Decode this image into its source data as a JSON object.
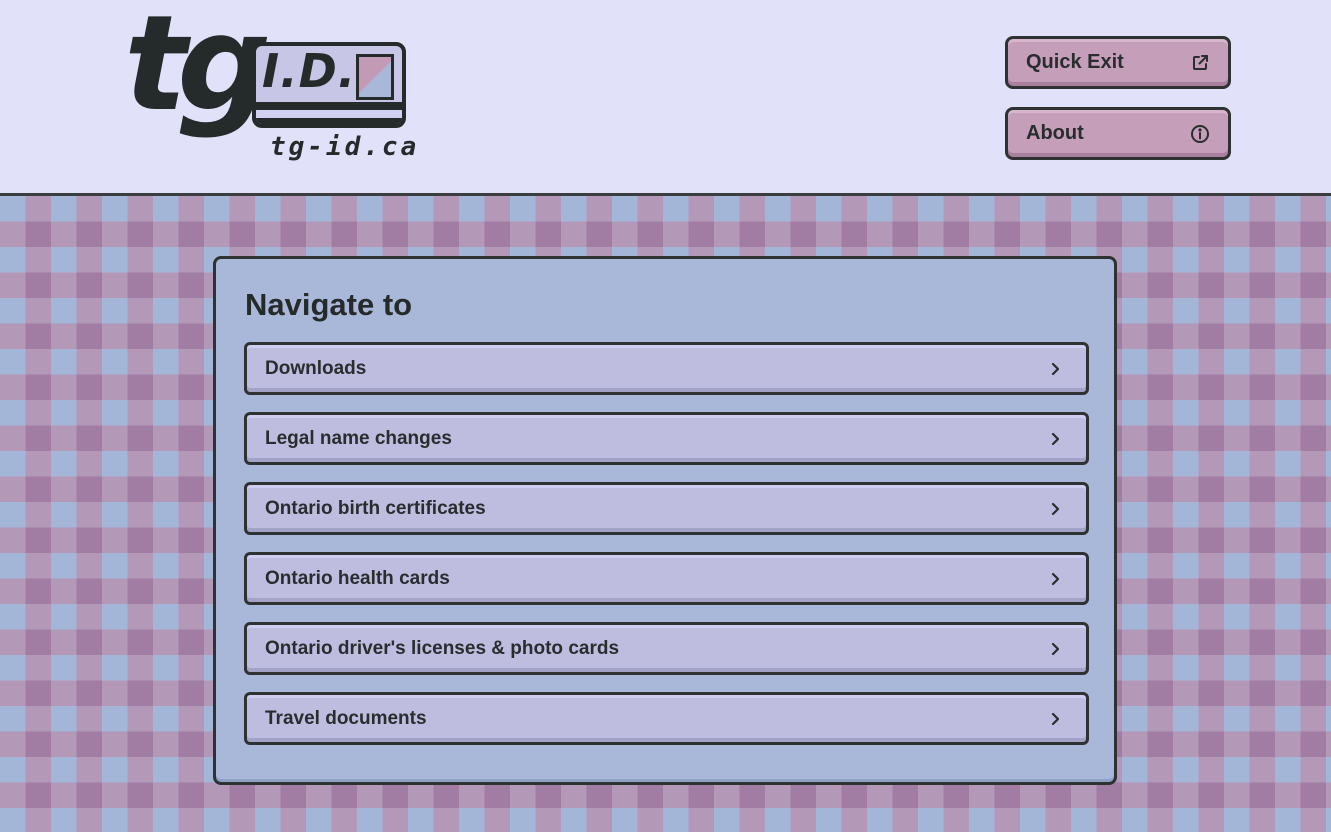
{
  "header": {
    "logo": {
      "wordmark": "tg",
      "card_text": "I.D.",
      "domain": "tg-id.ca"
    },
    "buttons": [
      {
        "label": "Quick Exit",
        "icon": "external-link-icon"
      },
      {
        "label": "About",
        "icon": "info-icon"
      }
    ]
  },
  "nav": {
    "title": "Navigate to",
    "items": [
      {
        "label": "Downloads",
        "icon": "chevron-right-icon"
      },
      {
        "label": "Legal name changes",
        "icon": "chevron-right-icon"
      },
      {
        "label": "Ontario birth certificates",
        "icon": "chevron-right-icon"
      },
      {
        "label": "Ontario health cards",
        "icon": "chevron-right-icon"
      },
      {
        "label": "Ontario driver's licenses & photo cards",
        "icon": "chevron-right-icon"
      },
      {
        "label": "Travel documents",
        "icon": "chevron-right-icon"
      }
    ]
  },
  "colors": {
    "header_bg": "#e2e1fa",
    "button_bg": "#c59fb9",
    "panel_bg": "#a9b8d8",
    "nav_item_bg": "#bebde0",
    "text": "#252a2b",
    "pattern_pink": "#a27da3",
    "pattern_blue": "#a4b6d8"
  }
}
